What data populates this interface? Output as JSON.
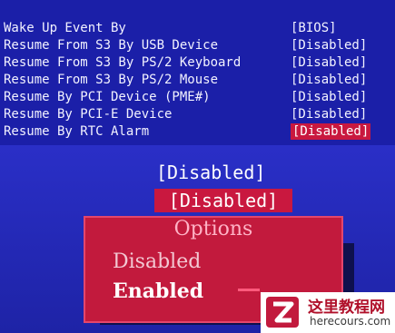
{
  "settings": [
    {
      "label": "Wake Up Event By",
      "value": "[BIOS]"
    },
    {
      "label": "Resume From S3 By USB Device",
      "value": "[Disabled]"
    },
    {
      "label": "Resume From S3 By PS/2 Keyboard",
      "value": "[Disabled]"
    },
    {
      "label": "Resume From S3 By PS/2 Mouse",
      "value": "[Disabled]"
    },
    {
      "label": "Resume By PCI Device (PME#)",
      "value": "[Disabled]"
    },
    {
      "label": "Resume By PCI-E Device",
      "value": "[Disabled]"
    },
    {
      "label": "Resume By RTC Alarm",
      "value": "[Disabled]"
    }
  ],
  "zoom": {
    "value_plain": "[Disabled]",
    "value_selected": "[Disabled]"
  },
  "options_popup": {
    "title": "Options",
    "items": [
      "Disabled",
      "Enabled"
    ],
    "selected": "Enabled"
  },
  "watermark": {
    "title": "这里教程网",
    "url": "herecours.com"
  },
  "colors": {
    "bios_blue": "#1b1fa8",
    "highlight_red": "#c9183f",
    "text": "#f2f2ff"
  }
}
